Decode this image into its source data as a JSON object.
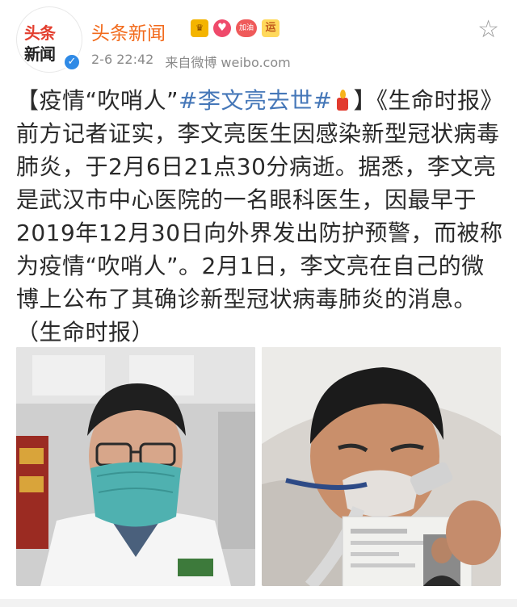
{
  "user": {
    "name": "头条新闻",
    "avatar_logo_top": "头条",
    "avatar_logo_bottom": "新闻",
    "badges": [
      "crown-badge",
      "heart-badge",
      "加油",
      "运"
    ],
    "post_time": "2-6 22:42",
    "source": "来自微博 weibo.com"
  },
  "post": {
    "segment_1": "【疫情“吹哨人”",
    "hashtag": "#李文亮去世#",
    "segment_2": "】《生命时报》前方记者证实，李文亮医生因感染新型冠状病毒肺炎，于2月6日21点30分病逝。据悉，李文亮是武汉市中心医院的一名眼科医生，因最早于2019年12月30日向外界发出防护预警，而被称为疫情“吹哨人”。2月1日，李文亮在自己的微博上公布了其确诊新型冠状病毒肺炎的消息。（生命时报）"
  },
  "icons": {
    "verified": "verified-check-icon",
    "favorite": "star-icon",
    "candle": "candle-icon"
  },
  "colors": {
    "username": "#f26a1b",
    "hashtag": "#4577b8",
    "verified": "#2f8ae6"
  }
}
